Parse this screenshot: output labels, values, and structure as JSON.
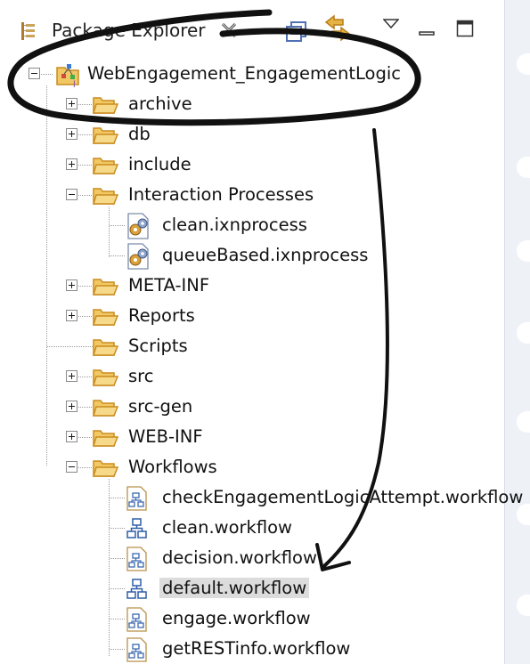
{
  "view": {
    "title": "Package Explorer",
    "title_icon": "package-explorer-icon",
    "toolbar_icons": [
      "close-icon",
      "collapse-all-icon",
      "link-with-editor-icon",
      "view-menu-icon",
      "minimize-icon",
      "maximize-icon"
    ]
  },
  "tree": {
    "project": {
      "label": "WebEngagement_EngagementLogic",
      "icon": "project-icon",
      "expanded": true
    },
    "items": [
      {
        "label": "archive",
        "icon": "folder-icon",
        "expandable": true,
        "expanded": false
      },
      {
        "label": "db",
        "icon": "folder-icon",
        "expandable": true,
        "expanded": false
      },
      {
        "label": "include",
        "icon": "folder-icon",
        "expandable": true,
        "expanded": false
      },
      {
        "label": "Interaction Processes",
        "icon": "folder-icon",
        "expandable": true,
        "expanded": true,
        "children": [
          {
            "label": "clean.ixnprocess",
            "icon": "ixnprocess-icon"
          },
          {
            "label": "queueBased.ixnprocess",
            "icon": "ixnprocess-icon"
          }
        ]
      },
      {
        "label": "META-INF",
        "icon": "folder-icon",
        "expandable": true,
        "expanded": false
      },
      {
        "label": "Reports",
        "icon": "folder-icon",
        "expandable": true,
        "expanded": false
      },
      {
        "label": "Scripts",
        "icon": "folder-icon",
        "expandable": false,
        "expanded": false
      },
      {
        "label": "src",
        "icon": "folder-icon",
        "expandable": true,
        "expanded": false
      },
      {
        "label": "src-gen",
        "icon": "folder-icon",
        "expandable": true,
        "expanded": false
      },
      {
        "label": "WEB-INF",
        "icon": "folder-icon",
        "expandable": true,
        "expanded": false
      },
      {
        "label": "Workflows",
        "icon": "folder-icon",
        "expandable": true,
        "expanded": true,
        "children": [
          {
            "label": "checkEngagementLogicAttempt.workflow",
            "icon": "workflow-file-icon"
          },
          {
            "label": "clean.workflow",
            "icon": "workflow-icon"
          },
          {
            "label": "decision.workflow",
            "icon": "workflow-file-icon"
          },
          {
            "label": "default.workflow",
            "icon": "workflow-icon",
            "selected": true
          },
          {
            "label": "engage.workflow",
            "icon": "workflow-file-icon"
          },
          {
            "label": "getRESTinfo.workflow",
            "icon": "workflow-file-icon"
          }
        ]
      }
    ]
  },
  "annotation": {
    "ellipse_color": "#111111",
    "arrow_color": "#111111",
    "description_icons": [
      "highlight-ellipse",
      "pointer-arrow"
    ]
  },
  "colors": {
    "folder": "#f2c864",
    "folder_edge": "#c98c1e",
    "selection": "#dcdcdc",
    "tree_lines": "#9a9a9a"
  }
}
